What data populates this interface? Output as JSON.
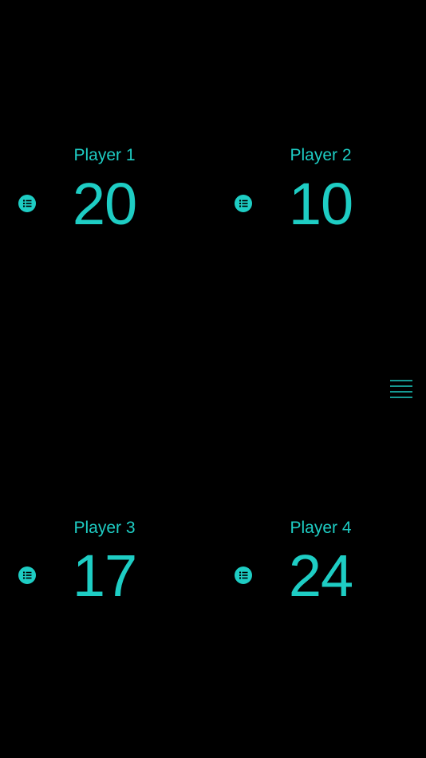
{
  "accent_color": "#1ecdc4",
  "background_color": "#000000",
  "players": [
    {
      "name": "Player 1",
      "score": "20",
      "history_icon": "list-icon"
    },
    {
      "name": "Player 2",
      "score": "10",
      "history_icon": "list-icon"
    },
    {
      "name": "Player 3",
      "score": "17",
      "history_icon": "list-icon"
    },
    {
      "name": "Player 4",
      "score": "24",
      "history_icon": "list-icon"
    }
  ],
  "menu": {
    "icon": "hamburger-menu-icon"
  }
}
